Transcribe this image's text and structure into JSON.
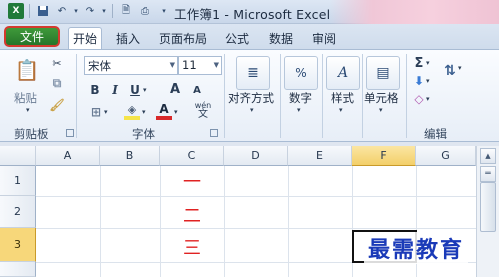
{
  "window": {
    "title": "工作簿1 - Microsoft Excel"
  },
  "quick_access": {
    "icons": [
      "excel-logo-icon",
      "save-icon",
      "undo-icon",
      "redo-icon",
      "print-preview-icon",
      "print-icon",
      "customize-icon"
    ]
  },
  "tabs": {
    "file": "文件",
    "items": [
      "开始",
      "插入",
      "页面布局",
      "公式",
      "数据",
      "审阅"
    ],
    "active": "开始"
  },
  "ribbon": {
    "clipboard": {
      "paste_label": "粘贴",
      "group_label": "剪贴板"
    },
    "font": {
      "font_name": "宋体",
      "font_size": "11",
      "group_label": "字体",
      "bold": "B",
      "italic": "I",
      "underline": "U",
      "grow": "A",
      "shrink": "A",
      "font_color_letter": "A",
      "wen": "wén"
    },
    "alignment": {
      "label": "对齐方式"
    },
    "number": {
      "label": "数字",
      "icon_text": "%"
    },
    "styles": {
      "label": "样式"
    },
    "cells": {
      "label": "单元格"
    },
    "editing": {
      "group_label": "编辑",
      "sum": "Σ"
    }
  },
  "sheet": {
    "columns": [
      "A",
      "B",
      "C",
      "D",
      "E",
      "F",
      "G"
    ],
    "rows": [
      "1",
      "2",
      "3"
    ],
    "selected_column": "F",
    "selected_row": "3",
    "cells": {
      "C1": "一",
      "C2": "二",
      "C3": "三"
    }
  },
  "watermark": "最需教育"
}
